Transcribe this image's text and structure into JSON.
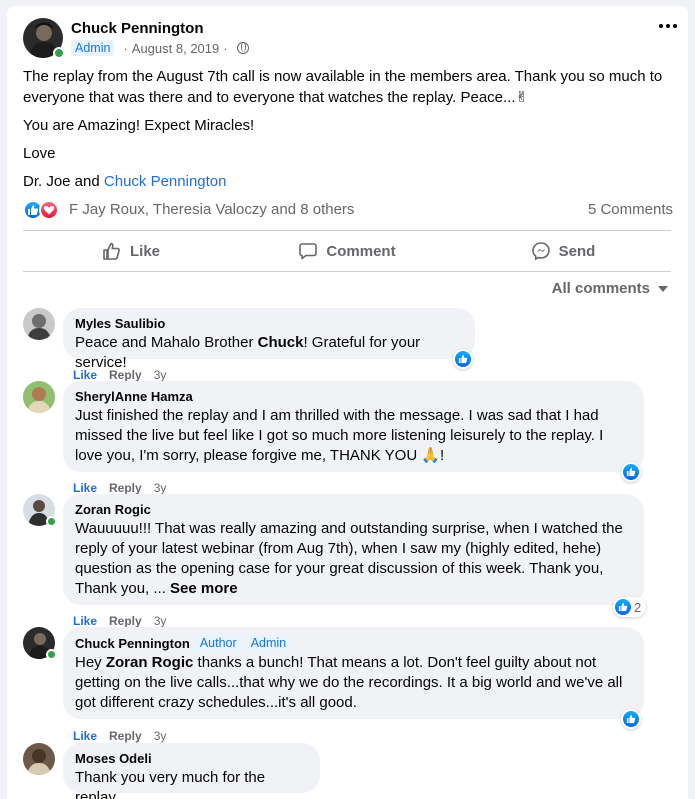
{
  "post": {
    "author": "Chuck Pennington",
    "badge": "Admin",
    "date": "August 8, 2019",
    "separator": "·",
    "paragraphs": {
      "p1": "The replay from the August 7th call is now available in the members area. Thank you so much to everyone that was there and to everyone that watches the replay. Peace...✌",
      "p2": "You are Amazing! Expect Miracles!",
      "p3": "Love",
      "p4_prefix": "Dr. Joe and ",
      "p4_link": "Chuck Pennington"
    },
    "reactions_names": "F Jay Roux, Theresia Valoczy and 8 others",
    "comments_count": "5 Comments"
  },
  "actions": {
    "like": "Like",
    "comment": "Comment",
    "send": "Send"
  },
  "filter": {
    "label": "All comments"
  },
  "comments": [
    {
      "name": "Myles Saulibio",
      "text_a": "Peace and Mahalo Brother ",
      "text_b": "Chuck",
      "text_c": "! Grateful for your service!",
      "like": "Like",
      "reply": "Reply",
      "age": "3y"
    },
    {
      "name": "SherylAnne Hamza",
      "text": "Just finished the replay and I am thrilled with the message. I was sad that I had missed the live but feel like I got so much more listening leisurely to the replay. I love you, I'm sorry, please forgive me, THANK YOU 🙏!",
      "like": "Like",
      "reply": "Reply",
      "age": "3y"
    },
    {
      "name": "Zoran Rogic",
      "text": "Wauuuuu!!! That was really amazing and outstanding surprise, when I watched the reply of your latest webinar (from Aug 7th), when I saw my (highly edited, hehe) question as the opening case for your great discussion of this week. Thank you, Thank you, ... ",
      "see_more": "See more",
      "like": "Like",
      "reply": "Reply",
      "age": "3y",
      "reaction_count": "2"
    },
    {
      "name": "Chuck Pennington",
      "badge_author": "Author",
      "badge_admin": "Admin",
      "text_a": "Hey ",
      "text_b": "Zoran Rogic",
      "text_c": " thanks a bunch! That means a lot. Don't feel guilty about not getting on the live calls...that why we do the recordings. It a big world and we've all got different crazy schedules...it's all good.",
      "like": "Like",
      "reply": "Reply",
      "age": "3y"
    },
    {
      "name": "Moses Odeli",
      "text": "Thank you very much for the replay."
    }
  ],
  "colors": {
    "link_blue": "#216fdb",
    "online_green": "#31a24c",
    "badge_bg": "#e7f3ff"
  }
}
